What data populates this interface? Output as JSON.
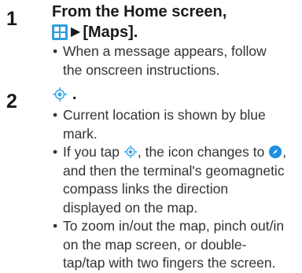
{
  "steps": [
    {
      "number": "1",
      "title_line1": "From the Home screen,",
      "title_line2_icon": "apps-grid-icon",
      "title_line2_arrow": "▶",
      "title_line2_text": "[Maps].",
      "bullets": [
        "When a message appears, follow the onscreen instructions."
      ]
    },
    {
      "number": "2",
      "title_icon": "location-target-icon",
      "title_period": ".",
      "bullets": [
        {
          "text": "Current location is shown by blue mark."
        },
        {
          "text_before": "If you tap ",
          "icon1": "location-target-icon",
          "text_middle": ", the icon changes to ",
          "icon2": "compass-icon",
          "text_after": ", and then the terminal's geomagnetic compass links the direction displayed on the map."
        },
        {
          "text": "To zoom in/out the map, pinch out/in on the map screen, or double-tap/tap with two fingers the screen."
        }
      ]
    }
  ],
  "colors": {
    "apps_icon_blue": "#2f9fe0",
    "location_icon_blue": "#3aa8e8",
    "compass_blue": "#1e90e0",
    "text": "#333333"
  }
}
